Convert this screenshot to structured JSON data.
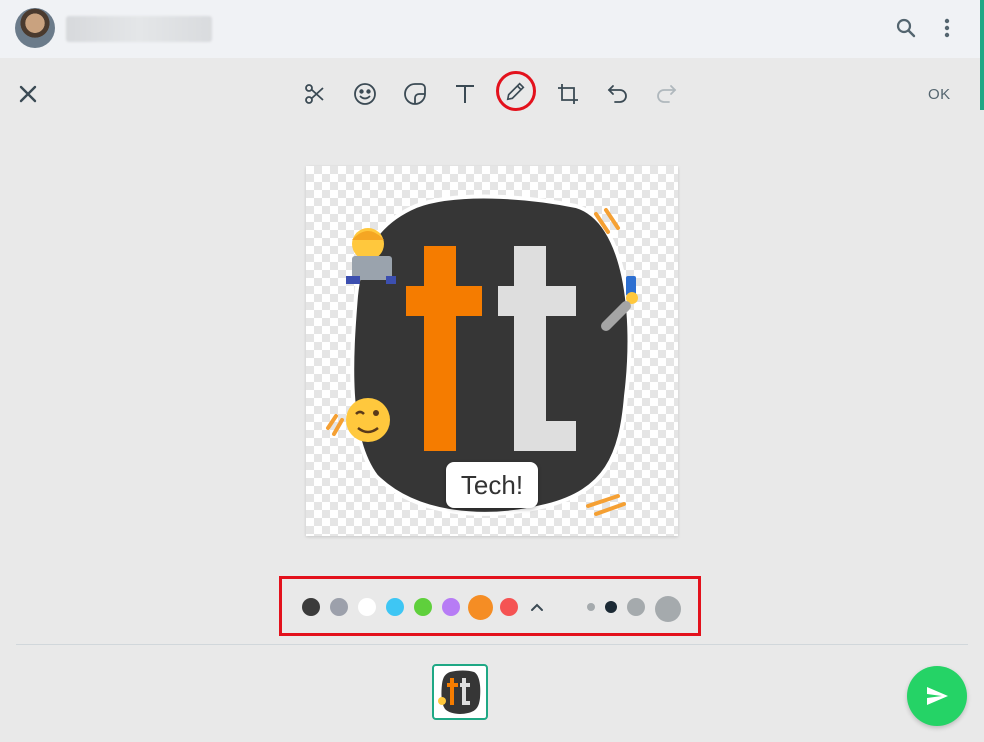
{
  "header": {
    "contact_name": "",
    "icons": [
      "search-icon",
      "menu-icon"
    ]
  },
  "toolbar": {
    "close_icon": "close-icon",
    "tools": [
      "scissors-icon",
      "emoji-icon",
      "sticker-icon",
      "text-icon",
      "pencil-icon",
      "crop-icon",
      "undo-icon",
      "redo-icon"
    ],
    "active_tool": "pencil-icon",
    "ok_label": "OK"
  },
  "sticker": {
    "label": "Tech!",
    "colors": {
      "blob": "#363636",
      "orange": "#f57c00",
      "light": "#dedede"
    }
  },
  "palette": {
    "colors": [
      "#3b3b3b",
      "#9ca0ab",
      "#ffffff",
      "#3ec6f4",
      "#5fd03c",
      "#b77cf5",
      "#f58d24",
      "#f55353"
    ],
    "selected_color": "#f58d24",
    "expand_icon": "chevron-up-icon",
    "brush_sizes": [
      "small",
      "medium",
      "large",
      "xlarge"
    ],
    "selected_brush_size": "medium"
  },
  "footer": {
    "send_icon": "send-icon",
    "accent": "#25d366"
  }
}
